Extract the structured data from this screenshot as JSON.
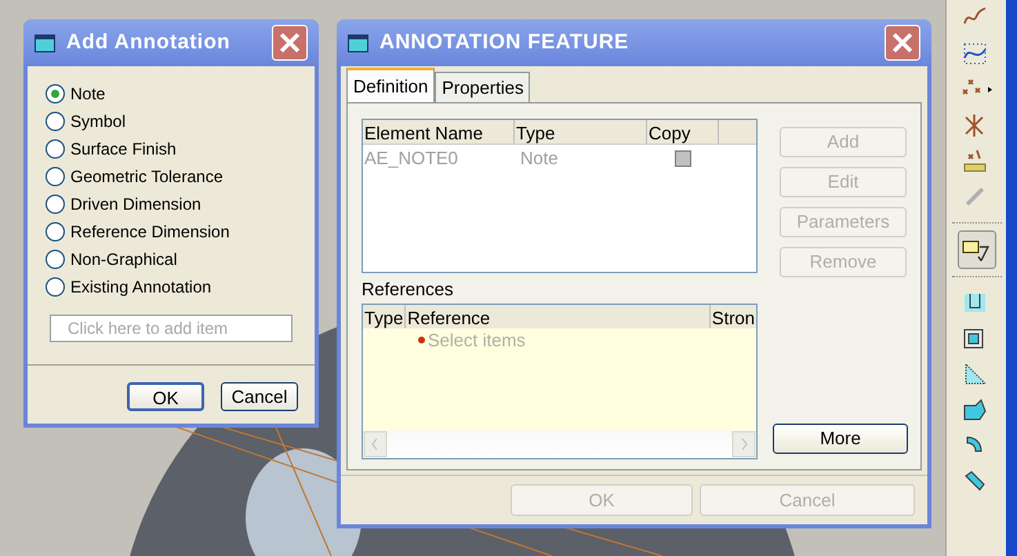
{
  "add_annotation": {
    "title": "Add Annotation",
    "options": [
      {
        "label": "Note",
        "selected": true
      },
      {
        "label": "Symbol",
        "selected": false
      },
      {
        "label": "Surface Finish",
        "selected": false
      },
      {
        "label": "Geometric Tolerance",
        "selected": false
      },
      {
        "label": "Driven Dimension",
        "selected": false
      },
      {
        "label": "Reference Dimension",
        "selected": false
      },
      {
        "label": "Non-Graphical",
        "selected": false
      },
      {
        "label": "Existing Annotation",
        "selected": false
      }
    ],
    "input": {
      "placeholder": "Click here to add item"
    },
    "buttons": [
      {
        "label": "OK",
        "default": true
      },
      {
        "label": "Cancel",
        "default": false
      }
    ]
  },
  "annotation_feature": {
    "title": "ANNOTATION FEATURE",
    "tabs": [
      {
        "label": "Definition",
        "selected": true
      },
      {
        "label": "Properties",
        "selected": false
      }
    ],
    "elements_table": {
      "columns": [
        "Element Name",
        "Type",
        "Copy"
      ],
      "rows": [
        {
          "name": "AE_NOTE0",
          "type": "Note",
          "copy": false,
          "disabled": true
        }
      ]
    },
    "side_buttons": [
      {
        "label": "Add",
        "disabled": true
      },
      {
        "label": "Edit",
        "disabled": true
      },
      {
        "label": "Parameters",
        "disabled": true
      },
      {
        "label": "Remove",
        "disabled": true
      }
    ],
    "references": {
      "label": "References",
      "columns": [
        "Type",
        "Reference",
        "Stron"
      ],
      "prompt": "Select items"
    },
    "more_button": {
      "label": "More",
      "disabled": false
    },
    "footer_buttons": [
      {
        "label": "OK",
        "disabled": true
      },
      {
        "label": "Cancel",
        "disabled": true
      }
    ]
  },
  "toolbar": {
    "items": [
      {
        "selected": false
      },
      {
        "selected": false
      },
      {
        "selected": false
      },
      {
        "selected": false
      },
      {
        "selected": false
      },
      {
        "selected": false
      },
      {
        "selected": true
      },
      {
        "selected": false
      },
      {
        "selected": false
      },
      {
        "selected": false
      },
      {
        "selected": false
      },
      {
        "selected": false
      },
      {
        "selected": false
      }
    ]
  }
}
